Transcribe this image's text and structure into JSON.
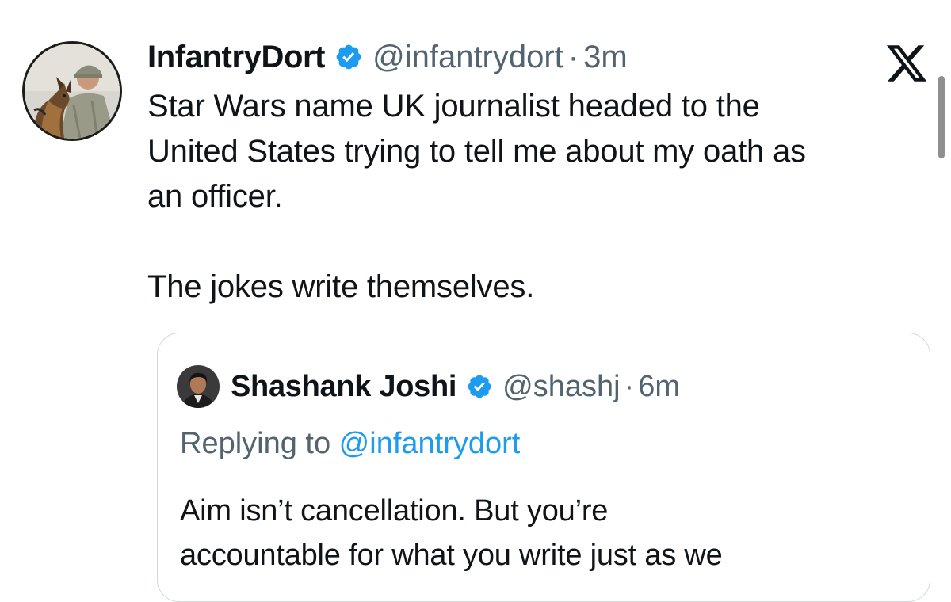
{
  "tweet": {
    "display_name": "InfantryDort",
    "handle": "@infantrydort",
    "separator": "·",
    "time": "3m",
    "body_lines": [
      "Star Wars name UK journalist headed to the",
      "United States trying to tell me about my oath as",
      "an officer.",
      "The jokes write themselves."
    ],
    "avatar_icon": "soldier-with-dog-avatar",
    "verified_icon": "verified-badge-icon"
  },
  "quote": {
    "display_name": "Shashank Joshi",
    "handle": "@shashj",
    "separator": "·",
    "time": "6m",
    "replying_prefix": "Replying to ",
    "replying_handle": "@infantrydort",
    "body_lines": [
      "Aim isn’t cancellation. But you’re",
      "accountable for what you write just as we"
    ],
    "avatar_icon": "profile-photo-avatar",
    "verified_icon": "verified-badge-icon"
  },
  "brand": {
    "logo_icon": "x-logo-icon"
  },
  "colors": {
    "text": "#0f1419",
    "secondary": "#536471",
    "accent": "#1d9bf0",
    "border": "#cfd9de"
  }
}
